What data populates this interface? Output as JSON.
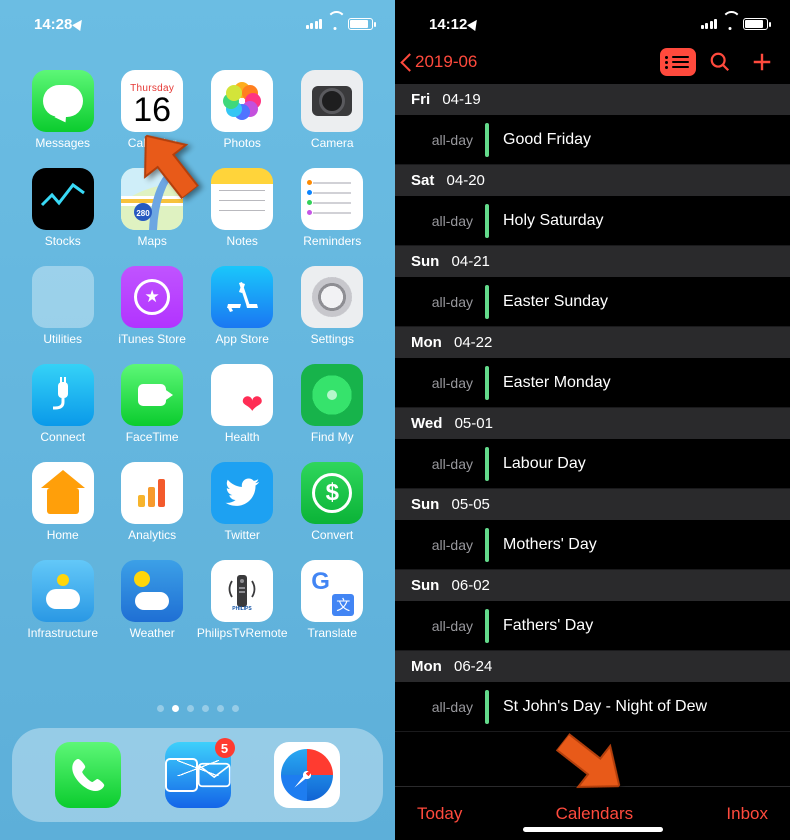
{
  "home": {
    "status": {
      "time": "14:28"
    },
    "calendar_tile": {
      "weekday": "Thursday",
      "day": "16"
    },
    "apps": {
      "messages": "Messages",
      "calendar": "Calendar",
      "photos": "Photos",
      "camera": "Camera",
      "stocks": "Stocks",
      "maps": "Maps",
      "notes": "Notes",
      "reminders": "Reminders",
      "utilities": "Utilities",
      "itunes": "iTunes Store",
      "appstore": "App Store",
      "settings": "Settings",
      "connect": "Connect",
      "facetime": "FaceTime",
      "health": "Health",
      "findmy": "Find My",
      "homeapp": "Home",
      "analytics": "Analytics",
      "twitter": "Twitter",
      "convert": "Convert",
      "infrastructure": "Infrastructure",
      "weather": "Weather",
      "philips": "PhilipsTvRemote",
      "translate": "Translate"
    },
    "pager": {
      "count": 6,
      "active": 1
    },
    "dock": {
      "mail_badge": "5"
    }
  },
  "calendar": {
    "status": {
      "time": "14:12"
    },
    "back_label": "2019-06",
    "events": [
      {
        "header_day": "Fri",
        "header_date": "04-19",
        "when": "all-day",
        "title": "Good Friday"
      },
      {
        "header_day": "Sat",
        "header_date": "04-20",
        "when": "all-day",
        "title": "Holy Saturday"
      },
      {
        "header_day": "Sun",
        "header_date": "04-21",
        "when": "all-day",
        "title": "Easter Sunday"
      },
      {
        "header_day": "Mon",
        "header_date": "04-22",
        "when": "all-day",
        "title": "Easter Monday"
      },
      {
        "header_day": "Wed",
        "header_date": "05-01",
        "when": "all-day",
        "title": "Labour Day"
      },
      {
        "header_day": "Sun",
        "header_date": "05-05",
        "when": "all-day",
        "title": "Mothers' Day"
      },
      {
        "header_day": "Sun",
        "header_date": "06-02",
        "when": "all-day",
        "title": "Fathers' Day"
      },
      {
        "header_day": "Mon",
        "header_date": "06-24",
        "when": "all-day",
        "title": "St John's Day - Night of Dew"
      }
    ],
    "footer": {
      "today": "Today",
      "calendars": "Calendars",
      "inbox": "Inbox"
    }
  }
}
